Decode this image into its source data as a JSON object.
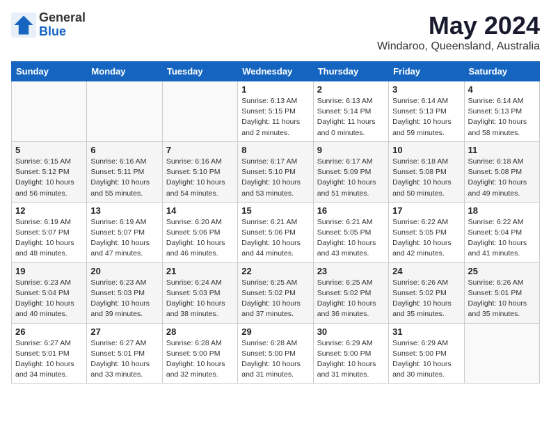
{
  "logo": {
    "general": "General",
    "blue": "Blue"
  },
  "title": "May 2024",
  "location": "Windaroo, Queensland, Australia",
  "headers": [
    "Sunday",
    "Monday",
    "Tuesday",
    "Wednesday",
    "Thursday",
    "Friday",
    "Saturday"
  ],
  "weeks": [
    [
      {
        "day": "",
        "info": ""
      },
      {
        "day": "",
        "info": ""
      },
      {
        "day": "",
        "info": ""
      },
      {
        "day": "1",
        "info": "Sunrise: 6:13 AM\nSunset: 5:15 PM\nDaylight: 11 hours\nand 2 minutes."
      },
      {
        "day": "2",
        "info": "Sunrise: 6:13 AM\nSunset: 5:14 PM\nDaylight: 11 hours\nand 0 minutes."
      },
      {
        "day": "3",
        "info": "Sunrise: 6:14 AM\nSunset: 5:13 PM\nDaylight: 10 hours\nand 59 minutes."
      },
      {
        "day": "4",
        "info": "Sunrise: 6:14 AM\nSunset: 5:13 PM\nDaylight: 10 hours\nand 58 minutes."
      }
    ],
    [
      {
        "day": "5",
        "info": "Sunrise: 6:15 AM\nSunset: 5:12 PM\nDaylight: 10 hours\nand 56 minutes."
      },
      {
        "day": "6",
        "info": "Sunrise: 6:16 AM\nSunset: 5:11 PM\nDaylight: 10 hours\nand 55 minutes."
      },
      {
        "day": "7",
        "info": "Sunrise: 6:16 AM\nSunset: 5:10 PM\nDaylight: 10 hours\nand 54 minutes."
      },
      {
        "day": "8",
        "info": "Sunrise: 6:17 AM\nSunset: 5:10 PM\nDaylight: 10 hours\nand 53 minutes."
      },
      {
        "day": "9",
        "info": "Sunrise: 6:17 AM\nSunset: 5:09 PM\nDaylight: 10 hours\nand 51 minutes."
      },
      {
        "day": "10",
        "info": "Sunrise: 6:18 AM\nSunset: 5:08 PM\nDaylight: 10 hours\nand 50 minutes."
      },
      {
        "day": "11",
        "info": "Sunrise: 6:18 AM\nSunset: 5:08 PM\nDaylight: 10 hours\nand 49 minutes."
      }
    ],
    [
      {
        "day": "12",
        "info": "Sunrise: 6:19 AM\nSunset: 5:07 PM\nDaylight: 10 hours\nand 48 minutes."
      },
      {
        "day": "13",
        "info": "Sunrise: 6:19 AM\nSunset: 5:07 PM\nDaylight: 10 hours\nand 47 minutes."
      },
      {
        "day": "14",
        "info": "Sunrise: 6:20 AM\nSunset: 5:06 PM\nDaylight: 10 hours\nand 46 minutes."
      },
      {
        "day": "15",
        "info": "Sunrise: 6:21 AM\nSunset: 5:06 PM\nDaylight: 10 hours\nand 44 minutes."
      },
      {
        "day": "16",
        "info": "Sunrise: 6:21 AM\nSunset: 5:05 PM\nDaylight: 10 hours\nand 43 minutes."
      },
      {
        "day": "17",
        "info": "Sunrise: 6:22 AM\nSunset: 5:05 PM\nDaylight: 10 hours\nand 42 minutes."
      },
      {
        "day": "18",
        "info": "Sunrise: 6:22 AM\nSunset: 5:04 PM\nDaylight: 10 hours\nand 41 minutes."
      }
    ],
    [
      {
        "day": "19",
        "info": "Sunrise: 6:23 AM\nSunset: 5:04 PM\nDaylight: 10 hours\nand 40 minutes."
      },
      {
        "day": "20",
        "info": "Sunrise: 6:23 AM\nSunset: 5:03 PM\nDaylight: 10 hours\nand 39 minutes."
      },
      {
        "day": "21",
        "info": "Sunrise: 6:24 AM\nSunset: 5:03 PM\nDaylight: 10 hours\nand 38 minutes."
      },
      {
        "day": "22",
        "info": "Sunrise: 6:25 AM\nSunset: 5:02 PM\nDaylight: 10 hours\nand 37 minutes."
      },
      {
        "day": "23",
        "info": "Sunrise: 6:25 AM\nSunset: 5:02 PM\nDaylight: 10 hours\nand 36 minutes."
      },
      {
        "day": "24",
        "info": "Sunrise: 6:26 AM\nSunset: 5:02 PM\nDaylight: 10 hours\nand 35 minutes."
      },
      {
        "day": "25",
        "info": "Sunrise: 6:26 AM\nSunset: 5:01 PM\nDaylight: 10 hours\nand 35 minutes."
      }
    ],
    [
      {
        "day": "26",
        "info": "Sunrise: 6:27 AM\nSunset: 5:01 PM\nDaylight: 10 hours\nand 34 minutes."
      },
      {
        "day": "27",
        "info": "Sunrise: 6:27 AM\nSunset: 5:01 PM\nDaylight: 10 hours\nand 33 minutes."
      },
      {
        "day": "28",
        "info": "Sunrise: 6:28 AM\nSunset: 5:00 PM\nDaylight: 10 hours\nand 32 minutes."
      },
      {
        "day": "29",
        "info": "Sunrise: 6:28 AM\nSunset: 5:00 PM\nDaylight: 10 hours\nand 31 minutes."
      },
      {
        "day": "30",
        "info": "Sunrise: 6:29 AM\nSunset: 5:00 PM\nDaylight: 10 hours\nand 31 minutes."
      },
      {
        "day": "31",
        "info": "Sunrise: 6:29 AM\nSunset: 5:00 PM\nDaylight: 10 hours\nand 30 minutes."
      },
      {
        "day": "",
        "info": ""
      }
    ]
  ]
}
